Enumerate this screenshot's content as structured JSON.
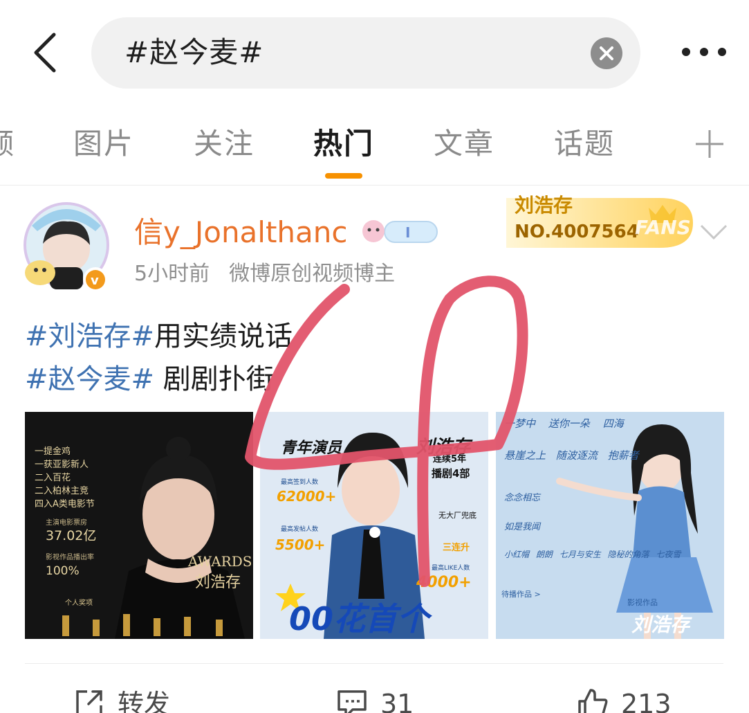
{
  "search": {
    "query": "#赵今麦#"
  },
  "tabs": [
    {
      "label": "频"
    },
    {
      "label": "图片"
    },
    {
      "label": "关注"
    },
    {
      "label": "热门"
    },
    {
      "label": "文章"
    },
    {
      "label": "话题"
    }
  ],
  "active_tab": "热门",
  "accent_color": "#f79100",
  "post": {
    "username": "信y_Jonalthanc",
    "time": "5小时前",
    "source": "微博原创视频博主",
    "fan_badge": {
      "name": "刘浩存",
      "number": "NO.4007564",
      "tag": "FANS"
    },
    "text": {
      "line1": {
        "hashtag": "#刘浩存#",
        "rest": "用实绩说话"
      },
      "line2": {
        "hashtag": "#赵今麦#",
        "rest": " 剧剧扑街"
      }
    },
    "images": {
      "img1": {
        "lines": [
          "一提金鸡",
          "一获亚影新人",
          "二入百花",
          "二入柏林主竞",
          "四入A类电影节"
        ],
        "box_office_label": "主演电影票房",
        "box_office": "37.02亿",
        "rate_label": "影视作品播出率",
        "rate": "100%",
        "awards": "AWARDS",
        "name": "刘浩存",
        "footer": "个人奖项"
      },
      "img2": {
        "title_left": "青年演员",
        "title_right": "刘浩存",
        "stat1_label": "最高签到人数",
        "stat1": "62000+",
        "stat2_label": "最高发帖人数",
        "stat2": "5500+",
        "stat3_label": "最高LIKE人数",
        "stat3": "4000+",
        "side1": "连续5年",
        "side2": "播剧4部",
        "side3": "无大厂兜底",
        "side4": "三连升",
        "headline": "00花首个"
      },
      "img3": {
        "titles": [
          "一梦中",
          "送你一朵",
          "四海",
          "悬崖之上",
          "随波逐流",
          "抱薪者",
          "念念相忘",
          "如是我闻",
          "小红帽",
          "朗朗",
          "七月与安生",
          "隐秘的角落",
          "七夜雪"
        ],
        "section": "待播作品 >",
        "footer_label": "影视作品",
        "footer_name": "刘浩存"
      }
    },
    "actions": {
      "repost": "转发",
      "comments": "31",
      "likes": "213"
    }
  }
}
